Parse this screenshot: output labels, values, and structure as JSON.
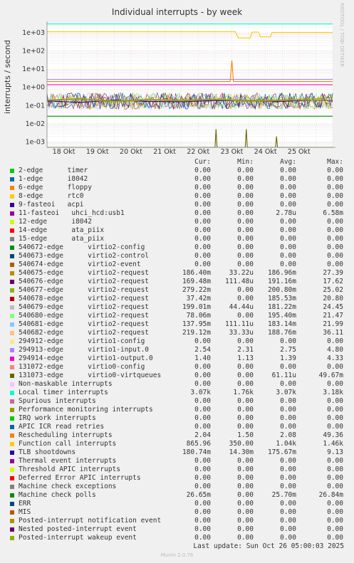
{
  "title": "Individual interrupts - by week",
  "ylabel": "interrupts / second",
  "side_text": "RRDTOOL / TOBI OETIKER",
  "headers": {
    "cur": "Cur:",
    "min": "Min:",
    "avg": "Avg:",
    "max": "Max:"
  },
  "legend": [
    {
      "name": "2-edge      timer",
      "color": "#00cc00",
      "cur": "0.00",
      "min": "0.00",
      "avg": "0.00",
      "max": "0.00"
    },
    {
      "name": "1-edge      i8042",
      "color": "#0066b3",
      "cur": "0.00",
      "min": "0.00",
      "avg": "0.00",
      "max": "0.00"
    },
    {
      "name": "6-edge      floppy",
      "color": "#ff8000",
      "cur": "0.00",
      "min": "0.00",
      "avg": "0.00",
      "max": "0.00"
    },
    {
      "name": "8-edge      rtc0",
      "color": "#ffcc00",
      "cur": "0.00",
      "min": "0.00",
      "avg": "0.00",
      "max": "0.00"
    },
    {
      "name": "9-fasteoi   acpi",
      "color": "#330099",
      "cur": "0.00",
      "min": "0.00",
      "avg": "0.00",
      "max": "0.00"
    },
    {
      "name": "11-fasteoi   uhci_hcd:usb1",
      "color": "#990099",
      "cur": "0.00",
      "min": "0.00",
      "avg": "2.78u",
      "max": "6.58m"
    },
    {
      "name": "12-edge      i8042",
      "color": "#ccff00",
      "cur": "0.00",
      "min": "0.00",
      "avg": "0.00",
      "max": "0.00"
    },
    {
      "name": "14-edge      ata_piix",
      "color": "#ff0000",
      "cur": "0.00",
      "min": "0.00",
      "avg": "0.00",
      "max": "0.00"
    },
    {
      "name": "15-edge      ata_piix",
      "color": "#808080",
      "cur": "0.00",
      "min": "0.00",
      "avg": "0.00",
      "max": "0.00"
    },
    {
      "name": "540672-edge      virtio2-config",
      "color": "#008f00",
      "cur": "0.00",
      "min": "0.00",
      "avg": "0.00",
      "max": "0.00"
    },
    {
      "name": "540673-edge      virtio2-control",
      "color": "#00487d",
      "cur": "0.00",
      "min": "0.00",
      "avg": "0.00",
      "max": "0.00"
    },
    {
      "name": "540674-edge      virtio2-event",
      "color": "#b35a00",
      "cur": "0.00",
      "min": "0.00",
      "avg": "0.00",
      "max": "0.00"
    },
    {
      "name": "540675-edge      virtio2-request",
      "color": "#b38f00",
      "cur": "186.40m",
      "min": "33.22u",
      "avg": "186.96m",
      "max": "27.39"
    },
    {
      "name": "540676-edge      virtio2-request",
      "color": "#6b006b",
      "cur": "169.48m",
      "min": "111.48u",
      "avg": "191.16m",
      "max": "17.62"
    },
    {
      "name": "540677-edge      virtio2-request",
      "color": "#8fb300",
      "cur": "279.22m",
      "min": "0.00",
      "avg": "200.80m",
      "max": "25.02"
    },
    {
      "name": "540678-edge      virtio2-request",
      "color": "#b30000",
      "cur": "37.42m",
      "min": "0.00",
      "avg": "185.53m",
      "max": "20.80"
    },
    {
      "name": "540679-edge      virtio2-request",
      "color": "#bebebe",
      "cur": "199.01m",
      "min": "44.44u",
      "avg": "181.22m",
      "max": "24.45"
    },
    {
      "name": "540680-edge      virtio2-request",
      "color": "#80ff80",
      "cur": "78.06m",
      "min": "0.00",
      "avg": "195.40m",
      "max": "21.47"
    },
    {
      "name": "540681-edge      virtio2-request",
      "color": "#80c9ff",
      "cur": "137.95m",
      "min": "111.11u",
      "avg": "183.14m",
      "max": "21.99"
    },
    {
      "name": "540682-edge      virtio2-request",
      "color": "#ffc080",
      "cur": "219.12m",
      "min": "33.33u",
      "avg": "188.76m",
      "max": "36.11"
    },
    {
      "name": "294912-edge      virtio1-config",
      "color": "#ffe680",
      "cur": "0.00",
      "min": "0.00",
      "avg": "0.00",
      "max": "0.00"
    },
    {
      "name": "294913-edge      virtio1-input.0",
      "color": "#aa80ff",
      "cur": "2.54",
      "min": "2.31",
      "avg": "2.75",
      "max": "4.80"
    },
    {
      "name": "294914-edge      virtio1-output.0",
      "color": "#ee00cc",
      "cur": "1.40",
      "min": "1.13",
      "avg": "1.39",
      "max": "4.33"
    },
    {
      "name": "131072-edge      virtio0-config",
      "color": "#ff8080",
      "cur": "0.00",
      "min": "0.00",
      "avg": "0.00",
      "max": "0.00"
    },
    {
      "name": "131073-edge      virtio0-virtqueues",
      "color": "#666600",
      "cur": "0.00",
      "min": "0.00",
      "avg": "61.11u",
      "max": "49.67m"
    },
    {
      "name": "Non-maskable interrupts",
      "color": "#ffbfff",
      "cur": "0.00",
      "min": "0.00",
      "avg": "0.00",
      "max": "0.00"
    },
    {
      "name": "Local timer interrupts",
      "color": "#00ffcc",
      "cur": "3.07k",
      "min": "1.76k",
      "avg": "3.07k",
      "max": "3.18k"
    },
    {
      "name": "Spurious interrupts",
      "color": "#cc6699",
      "cur": "0.00",
      "min": "0.00",
      "avg": "0.00",
      "max": "0.00"
    },
    {
      "name": "Performance monitoring interrupts",
      "color": "#999900",
      "cur": "0.00",
      "min": "0.00",
      "avg": "0.00",
      "max": "0.00"
    },
    {
      "name": "IRQ work interrupts",
      "color": "#00cc00",
      "cur": "0.00",
      "min": "0.00",
      "avg": "0.00",
      "max": "0.00"
    },
    {
      "name": "APIC ICR read retries",
      "color": "#0066b3",
      "cur": "0.00",
      "min": "0.00",
      "avg": "0.00",
      "max": "0.00"
    },
    {
      "name": "Rescheduling interrupts",
      "color": "#ff8000",
      "cur": "2.04",
      "min": "1.50",
      "avg": "2.08",
      "max": "49.36"
    },
    {
      "name": "Function call interrupts",
      "color": "#ffcc00",
      "cur": "865.96",
      "min": "350.00",
      "avg": "1.04k",
      "max": "1.46k"
    },
    {
      "name": "TLB shootdowns",
      "color": "#330099",
      "cur": "180.74m",
      "min": "14.30m",
      "avg": "175.67m",
      "max": "9.13"
    },
    {
      "name": "Thermal event interrupts",
      "color": "#990099",
      "cur": "0.00",
      "min": "0.00",
      "avg": "0.00",
      "max": "0.00"
    },
    {
      "name": "Threshold APIC interrupts",
      "color": "#ccff00",
      "cur": "0.00",
      "min": "0.00",
      "avg": "0.00",
      "max": "0.00"
    },
    {
      "name": "Deferred Error APIC interrupts",
      "color": "#ff0000",
      "cur": "0.00",
      "min": "0.00",
      "avg": "0.00",
      "max": "0.00"
    },
    {
      "name": "Machine check exceptions",
      "color": "#808080",
      "cur": "0.00",
      "min": "0.00",
      "avg": "0.00",
      "max": "0.00"
    },
    {
      "name": "Machine check polls",
      "color": "#008f00",
      "cur": "26.65m",
      "min": "0.00",
      "avg": "25.70m",
      "max": "26.84m"
    },
    {
      "name": "ERR",
      "color": "#00487d",
      "cur": "0.00",
      "min": "0.00",
      "avg": "0.00",
      "max": "0.00"
    },
    {
      "name": "MIS",
      "color": "#b35a00",
      "cur": "0.00",
      "min": "0.00",
      "avg": "0.00",
      "max": "0.00"
    },
    {
      "name": "Posted-interrupt notification event",
      "color": "#b38f00",
      "cur": "0.00",
      "min": "0.00",
      "avg": "0.00",
      "max": "0.00"
    },
    {
      "name": "Nested posted-interrupt event",
      "color": "#6b006b",
      "cur": "0.00",
      "min": "0.00",
      "avg": "0.00",
      "max": "0.00"
    },
    {
      "name": "Posted-interrupt wakeup event",
      "color": "#8fb300",
      "cur": "0.00",
      "min": "0.00",
      "avg": "0.00",
      "max": "0.00"
    }
  ],
  "last_update": "Last update: Sun Oct 26 05:00:03 2025",
  "footer": "Munin 2.0.76",
  "chart_data": {
    "type": "line",
    "title": "Individual interrupts - by week",
    "ylabel": "interrupts / second",
    "yscale": "log",
    "ylim": [
      0.0005,
      3000
    ],
    "yticks": [
      {
        "v": 1000,
        "label": "1e+03"
      },
      {
        "v": 100,
        "label": "1e+02"
      },
      {
        "v": 10,
        "label": "1e+01"
      },
      {
        "v": 1,
        "label": "1e+00"
      },
      {
        "v": 0.1,
        "label": "1e-01"
      },
      {
        "v": 0.01,
        "label": "1e-02"
      },
      {
        "v": 0.001,
        "label": "1e-03"
      }
    ],
    "x_range": [
      0,
      8.5
    ],
    "xticks": [
      {
        "v": 0.5,
        "label": "18 Okt"
      },
      {
        "v": 1.5,
        "label": "19 Okt"
      },
      {
        "v": 2.5,
        "label": "20 Okt"
      },
      {
        "v": 3.5,
        "label": "21 Okt"
      },
      {
        "v": 4.5,
        "label": "22 Okt"
      },
      {
        "v": 5.5,
        "label": "23 Okt"
      },
      {
        "v": 6.5,
        "label": "24 Okt"
      },
      {
        "v": 7.5,
        "label": "25 Okt"
      }
    ],
    "series": [
      {
        "name": "Local timer interrupts",
        "color": "#00ffcc",
        "x": [
          0,
          8.5
        ],
        "y": [
          3070,
          3070
        ]
      },
      {
        "name": "Function call interrupts",
        "color": "#ffcc00",
        "x": [
          0,
          5.6,
          5.7,
          6.05,
          6.1,
          6.3,
          6.35,
          6.65,
          6.7,
          8.5
        ],
        "y": [
          1150,
          1150,
          520,
          520,
          1100,
          1100,
          600,
          600,
          1050,
          1050
        ]
      },
      {
        "name": "294913-edge virtio1-input.0",
        "color": "#aa80ff",
        "x": [
          0,
          8.5
        ],
        "y": [
          2.75,
          2.75
        ]
      },
      {
        "name": "Rescheduling interrupts",
        "color": "#ff8000",
        "x": [
          0,
          5.45,
          5.5,
          5.55,
          8.5
        ],
        "y": [
          2.08,
          2.08,
          30,
          2.08,
          2.08
        ]
      },
      {
        "name": "294914-edge virtio1-output.0",
        "color": "#ee00cc",
        "x": [
          0,
          8.5
        ],
        "y": [
          1.39,
          1.39
        ]
      },
      {
        "name": "TLB shootdowns",
        "color": "#330099",
        "x": [
          0,
          1,
          2,
          3,
          4,
          5,
          6,
          7,
          8,
          8.5
        ],
        "y": [
          0.18,
          0.15,
          0.2,
          0.17,
          0.16,
          0.19,
          0.18,
          0.17,
          0.2,
          0.18
        ]
      },
      {
        "name": "540675-edge virtio2-request",
        "color": "#b38f00",
        "x": [
          0,
          1,
          2,
          3,
          4,
          5,
          6,
          7,
          8,
          8.5
        ],
        "y": [
          0.19,
          0.22,
          0.16,
          0.2,
          0.18,
          0.21,
          0.17,
          0.19,
          0.2,
          0.19
        ]
      },
      {
        "name": "540677-edge virtio2-request",
        "color": "#8fb300",
        "x": [
          0,
          1,
          2,
          3,
          4,
          5,
          6,
          7,
          8,
          8.5
        ],
        "y": [
          0.2,
          0.25,
          0.18,
          0.22,
          0.2,
          0.23,
          0.19,
          0.21,
          0.24,
          0.28
        ]
      },
      {
        "name": "Machine check polls",
        "color": "#008f00",
        "x": [
          0,
          8.5
        ],
        "y": [
          0.0257,
          0.0257
        ]
      },
      {
        "name": "131073-edge virtio0-virtqueues",
        "color": "#666600",
        "x": [
          0,
          5.0,
          5.03,
          5.06,
          5.9,
          5.93,
          5.96,
          6.8,
          6.83,
          6.86,
          8.5
        ],
        "y": [
          0.0005,
          0.0005,
          0.005,
          0.0005,
          0.0005,
          0.005,
          0.0005,
          0.0005,
          0.002,
          0.0005,
          0.0005
        ]
      }
    ]
  }
}
